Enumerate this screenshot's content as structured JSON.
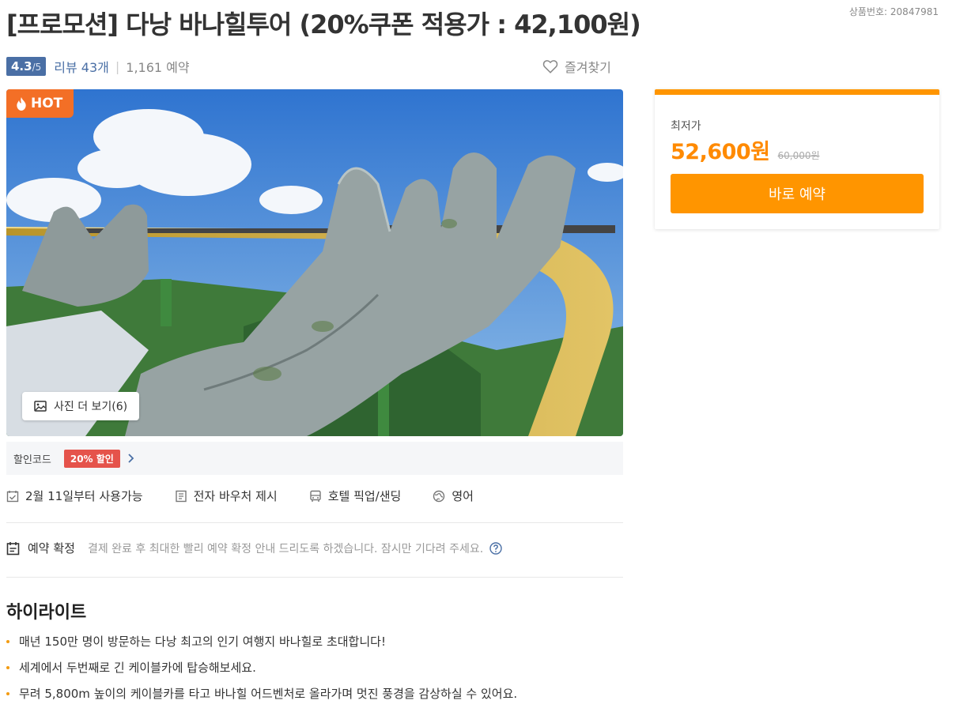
{
  "product": {
    "title": "[프로모션] 다낭 바나힐투어 (20%쿠폰 적용가 : 42,100원)",
    "code_label": "상품번호: 20847981"
  },
  "rating": {
    "score": "4.3",
    "max": "/5",
    "reviews": "리뷰 43개",
    "separator": "|",
    "bookings": "1,161 예약"
  },
  "favorite": {
    "label": "즐겨찾기",
    "icon": "heart-outline-icon"
  },
  "hero": {
    "badge": "HOT",
    "badge_icon": "fire-icon",
    "more_photos": "사진 더 보기(6)",
    "more_photos_icon": "image-icon"
  },
  "coupon": {
    "label": "할인코드",
    "tag": "20% 할인",
    "arrow_icon": "chevron-right-icon"
  },
  "features": [
    {
      "icon": "calendar-check-icon",
      "label": "2월 11일부터 사용가능"
    },
    {
      "icon": "voucher-icon",
      "label": "전자 바우처 제시"
    },
    {
      "icon": "bus-icon",
      "label": "호텔 픽업/샌딩"
    },
    {
      "icon": "globe-icon",
      "label": "영어"
    }
  ],
  "confirmation": {
    "icon": "clipboard-icon",
    "label": "예약 확정",
    "description": "결제 완료 후 최대한 빨리 예약 확정 안내 드리도록 하겠습니다. 잠시만 기다려 주세요.",
    "help_icon": "question-circle-icon"
  },
  "highlights": {
    "title": "하이라이트",
    "items": [
      "매년 150만 명이 방문하는 다낭 최고의 인기 여행지 바나힐로 초대합니다!",
      "세계에서 두번째로 긴 케이블카에 탑승해보세요.",
      "무려 5,800m 높이의 케이블카를 타고 바나힐 어드벤처로 올라가며 멋진 풍경을 감상하실 수 있어요."
    ]
  },
  "price_card": {
    "label": "최저가",
    "price": "52,600원",
    "original_price": "60,000원",
    "button": "바로 예약"
  },
  "colors": {
    "accent": "#ff9500",
    "price": "#ff8a00",
    "rating_badge": "#4a6fa5",
    "hot_badge": "#f36f26",
    "coupon_tag": "#e5534b"
  }
}
